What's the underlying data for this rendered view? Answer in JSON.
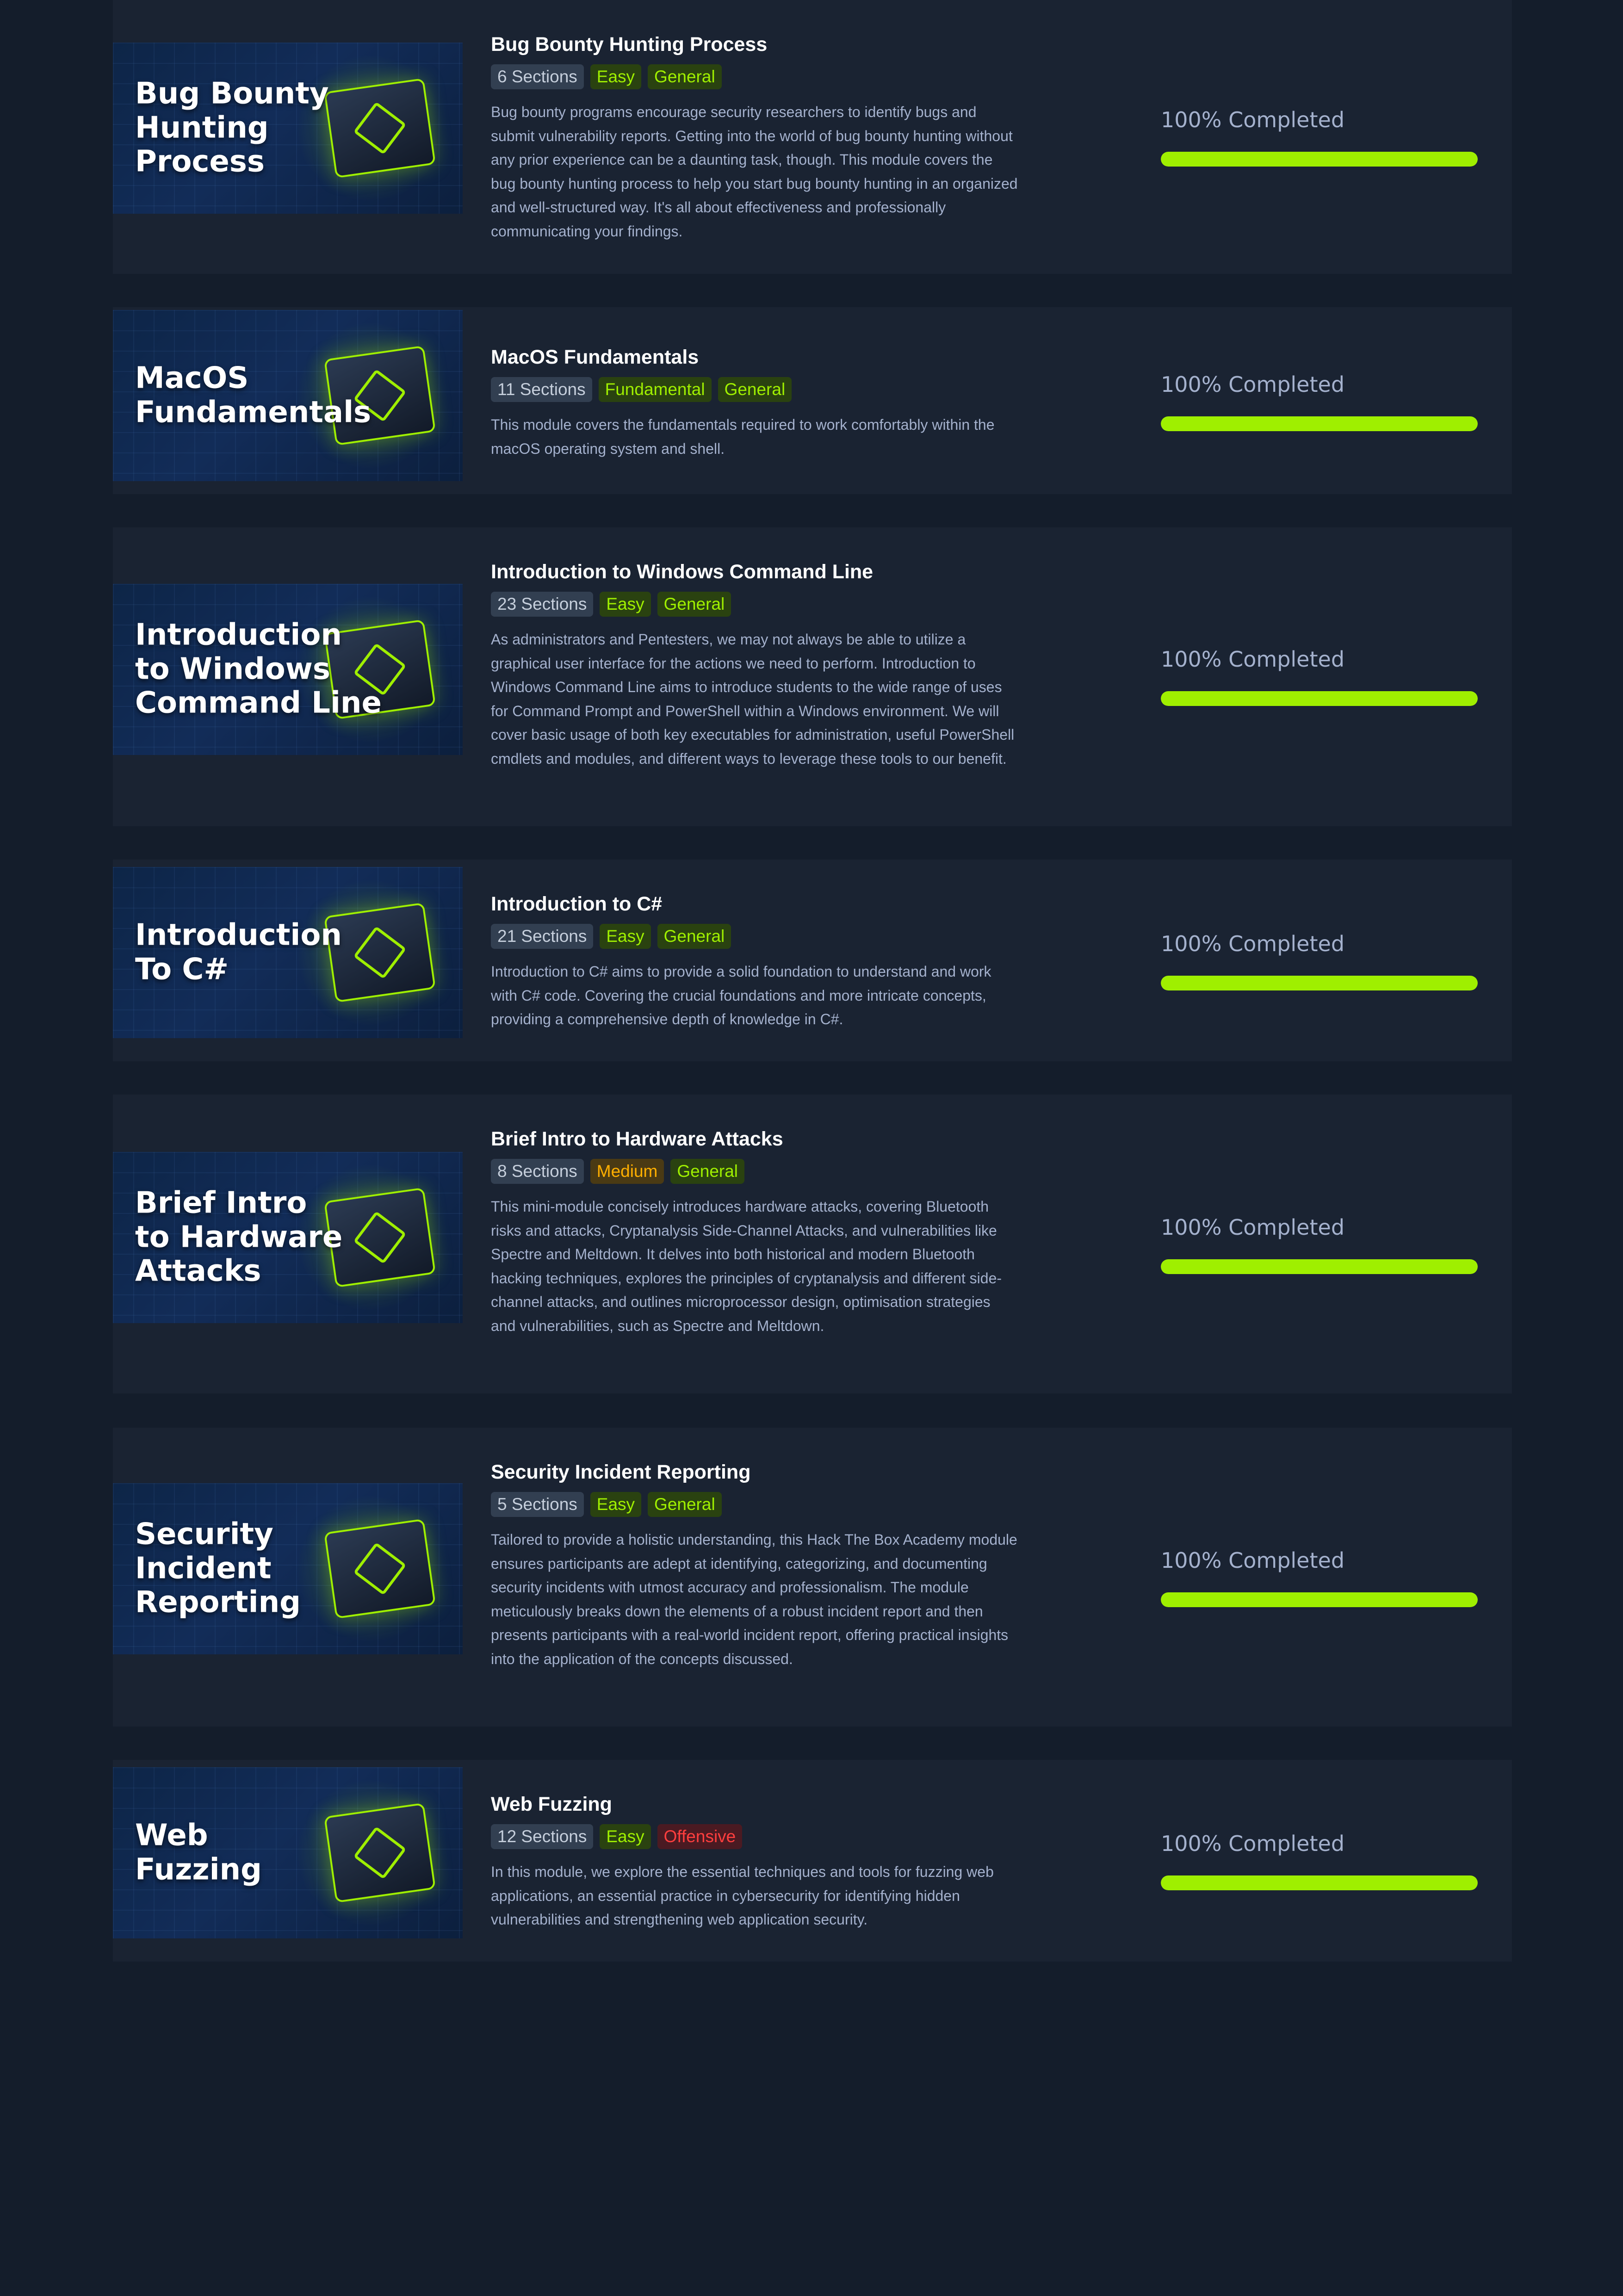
{
  "accent_color": "#9fef00",
  "modules": [
    {
      "thumb_text": "Bug Bounty\nHunting\nProcess",
      "title": "Bug Bounty Hunting Process",
      "tags": [
        {
          "label": "6 Sections",
          "kind": "sections"
        },
        {
          "label": "Easy",
          "kind": "easy"
        },
        {
          "label": "General",
          "kind": "general"
        }
      ],
      "description": "Bug bounty programs encourage security researchers to identify bugs and submit vulnerability reports. Getting into the world of bug bounty hunting without any prior experience can be a daunting task, though. This module covers the bug bounty hunting process to help you start bug bounty hunting in an organized and well-structured way. It's all about effectiveness and professionally communicating your findings.",
      "progress_label": "100% Completed",
      "progress": 1.0
    },
    {
      "thumb_text": "MacOS\nFundamentals",
      "title": "MacOS Fundamentals",
      "tags": [
        {
          "label": "11 Sections",
          "kind": "sections"
        },
        {
          "label": "Fundamental",
          "kind": "fundamental"
        },
        {
          "label": "General",
          "kind": "general"
        }
      ],
      "description": "This module covers the fundamentals required to work comfortably within the macOS operating system and shell.",
      "progress_label": "100% Completed",
      "progress": 1.0
    },
    {
      "thumb_text": "Introduction\nto Windows\nCommand Line",
      "title": "Introduction to Windows Command Line",
      "tags": [
        {
          "label": "23 Sections",
          "kind": "sections"
        },
        {
          "label": "Easy",
          "kind": "easy"
        },
        {
          "label": "General",
          "kind": "general"
        }
      ],
      "description": "As administrators and Pentesters, we may not always be able to utilize a graphical user interface for the actions we need to perform. Introduction to Windows Command Line aims to introduce students to the wide range of uses for Command Prompt and PowerShell within a Windows environment. We will cover basic usage of both key executables for administration, useful PowerShell cmdlets and modules, and different ways to leverage these tools to our benefit.",
      "progress_label": "100% Completed",
      "progress": 1.0
    },
    {
      "thumb_text": "Introduction\nTo C#",
      "title": "Introduction to C#",
      "tags": [
        {
          "label": "21 Sections",
          "kind": "sections"
        },
        {
          "label": "Easy",
          "kind": "easy"
        },
        {
          "label": "General",
          "kind": "general"
        }
      ],
      "description": "Introduction to C# aims to provide a solid foundation to understand and work with C# code. Covering the crucial foundations and more intricate concepts, providing a comprehensive depth of knowledge in C#.",
      "progress_label": "100% Completed",
      "progress": 1.0
    },
    {
      "thumb_text": "Brief Intro\nto Hardware\nAttacks",
      "title": "Brief Intro to Hardware Attacks",
      "tags": [
        {
          "label": "8 Sections",
          "kind": "sections"
        },
        {
          "label": "Medium",
          "kind": "medium"
        },
        {
          "label": "General",
          "kind": "general"
        }
      ],
      "description": "This mini-module concisely introduces hardware attacks, covering Bluetooth risks and attacks, Cryptanalysis Side-Channel Attacks, and vulnerabilities like Spectre and Meltdown. It delves into both historical and modern Bluetooth hacking techniques, explores the principles of cryptanalysis and different side-channel attacks, and outlines microprocessor design, optimisation strategies and vulnerabilities, such as Spectre and Meltdown.",
      "progress_label": "100% Completed",
      "progress": 1.0
    },
    {
      "thumb_text": "Security\nIncident\nReporting",
      "title": "Security Incident Reporting",
      "tags": [
        {
          "label": "5 Sections",
          "kind": "sections"
        },
        {
          "label": "Easy",
          "kind": "easy"
        },
        {
          "label": "General",
          "kind": "general"
        }
      ],
      "description": "Tailored to provide a holistic understanding, this Hack The Box Academy module ensures participants are adept at identifying, categorizing, and documenting security incidents with utmost accuracy and professionalism. The module meticulously breaks down the elements of a robust incident report and then presents participants with a real-world incident report, offering practical insights into the application of the concepts discussed.",
      "progress_label": "100% Completed",
      "progress": 1.0
    },
    {
      "thumb_text": "Web\nFuzzing",
      "title": "Web Fuzzing",
      "tags": [
        {
          "label": "12 Sections",
          "kind": "sections"
        },
        {
          "label": "Easy",
          "kind": "easy"
        },
        {
          "label": "Offensive",
          "kind": "offensive"
        }
      ],
      "description": "In this module, we explore the essential techniques and tools for fuzzing web applications, an essential practice in cybersecurity for identifying hidden vulnerabilities and strengthening web application security.",
      "progress_label": "100% Completed",
      "progress": 1.0
    }
  ]
}
